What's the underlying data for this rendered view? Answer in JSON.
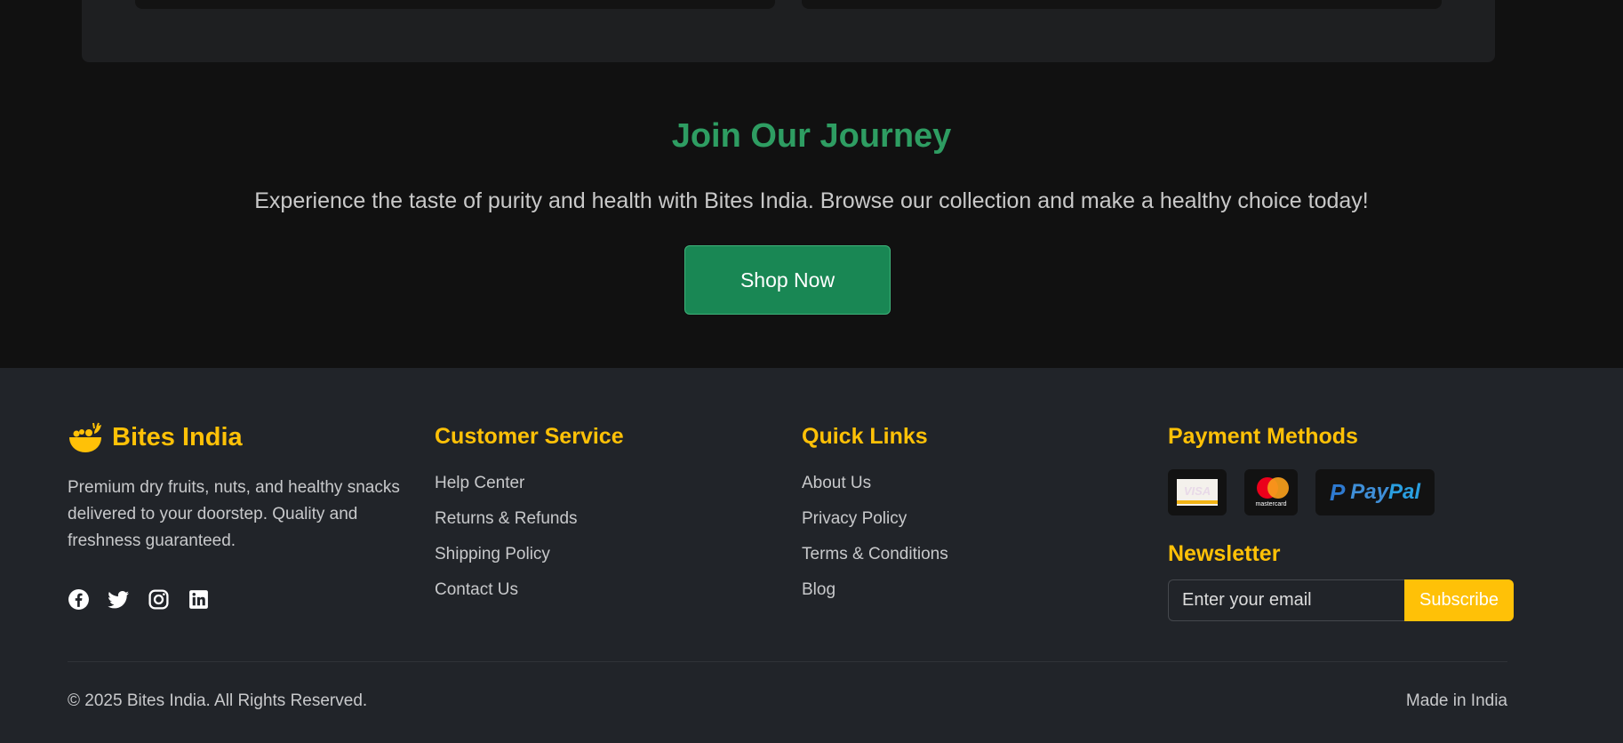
{
  "cta": {
    "title": "Join Our Journey",
    "subtitle": "Experience the taste of purity and health with Bites India. Browse our collection and make a healthy choice today!",
    "button_label": "Shop Now"
  },
  "footer": {
    "brand": {
      "name": "Bites India",
      "logo_icon": "fruit-bowl-icon",
      "description": "Premium dry fruits, nuts, and healthy snacks delivered to your doorstep. Quality and freshness guaranteed."
    },
    "socials": [
      "facebook-icon",
      "twitter-icon",
      "instagram-icon",
      "linkedin-icon"
    ],
    "customer_service": {
      "heading": "Customer Service",
      "links": [
        "Help Center",
        "Returns & Refunds",
        "Shipping Policy",
        "Contact Us"
      ]
    },
    "quick_links": {
      "heading": "Quick Links",
      "links": [
        "About Us",
        "Privacy Policy",
        "Terms & Conditions",
        "Blog"
      ]
    },
    "payment": {
      "heading": "Payment Methods",
      "visa_text": "VISA",
      "mastercard_text": "mastercard",
      "paypal_pay": "Pay",
      "paypal_pal": "Pal"
    },
    "newsletter": {
      "heading": "Newsletter",
      "placeholder": "Enter your email",
      "button_label": "Subscribe"
    },
    "copyright": "© 2025 Bites India. All Rights Reserved.",
    "made_in": "Made in India"
  },
  "colors": {
    "accent_yellow": "#ffc107",
    "accent_green": "#198754",
    "title_green": "#2e9d62",
    "footer_bg": "#212429",
    "page_bg": "#111111"
  }
}
